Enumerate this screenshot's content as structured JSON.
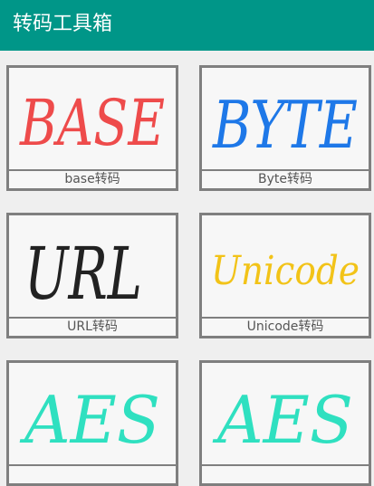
{
  "appbar": {
    "title": "转码工具箱",
    "color": "#009688"
  },
  "tools": [
    {
      "art_text": "BASE",
      "art_color": "#ee4b4b",
      "caption": "base转码"
    },
    {
      "art_text": "BYTE",
      "art_color": "#1e78e8",
      "caption": "Byte转码"
    },
    {
      "art_text": "URL",
      "art_color": "#222222",
      "caption": "URL转码"
    },
    {
      "art_text": "Unicode",
      "art_color": "#f2c318",
      "caption": "Unicode转码"
    },
    {
      "art_text": "AES",
      "art_color": "#2fe0c0",
      "caption": ""
    },
    {
      "art_text": "AES",
      "art_color": "#2fe0c0",
      "caption": ""
    }
  ]
}
